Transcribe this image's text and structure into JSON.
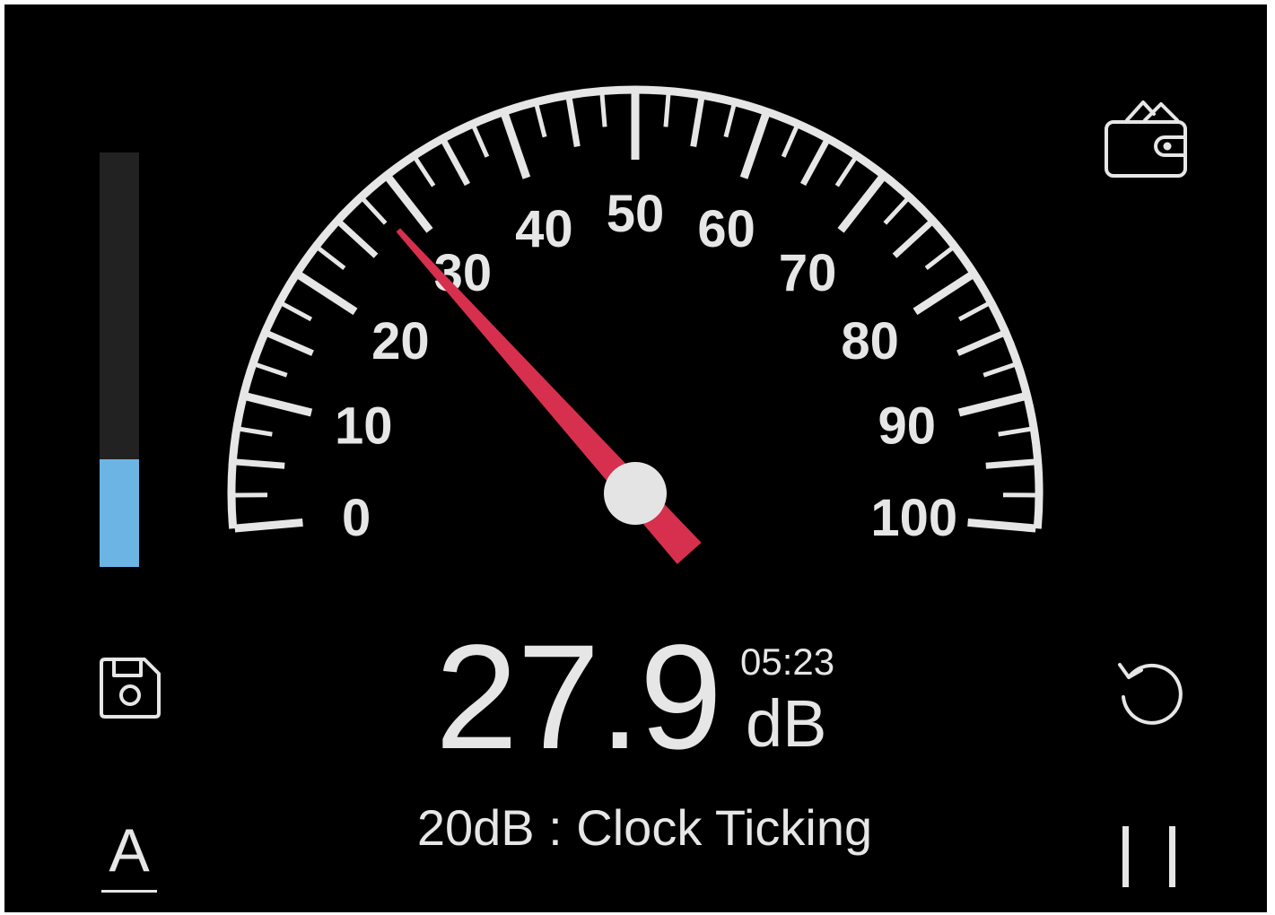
{
  "colors": {
    "background": "#000000",
    "gauge_foreground": "#e6e6e6",
    "needle": "#d6304e",
    "level_fill": "#6cb4e4",
    "level_track": "#222222"
  },
  "level_meter": {
    "fill_fraction": 0.26
  },
  "gauge": {
    "min": 0,
    "max": 100,
    "scale_labels": [
      "0",
      "10",
      "20",
      "30",
      "40",
      "50",
      "60",
      "70",
      "80",
      "90",
      "100"
    ],
    "needle_value": 27.9
  },
  "reading": {
    "value": "27.9",
    "unit": "dB",
    "elapsed": "05:23"
  },
  "reference_text": "20dB : Clock Ticking",
  "toolbar": {
    "font_button_letter": "A"
  },
  "icons": {
    "wallet": "wallet-icon",
    "save": "save-icon",
    "reset": "reset-icon",
    "pause": "pause-icon",
    "font": "font-size-icon"
  }
}
